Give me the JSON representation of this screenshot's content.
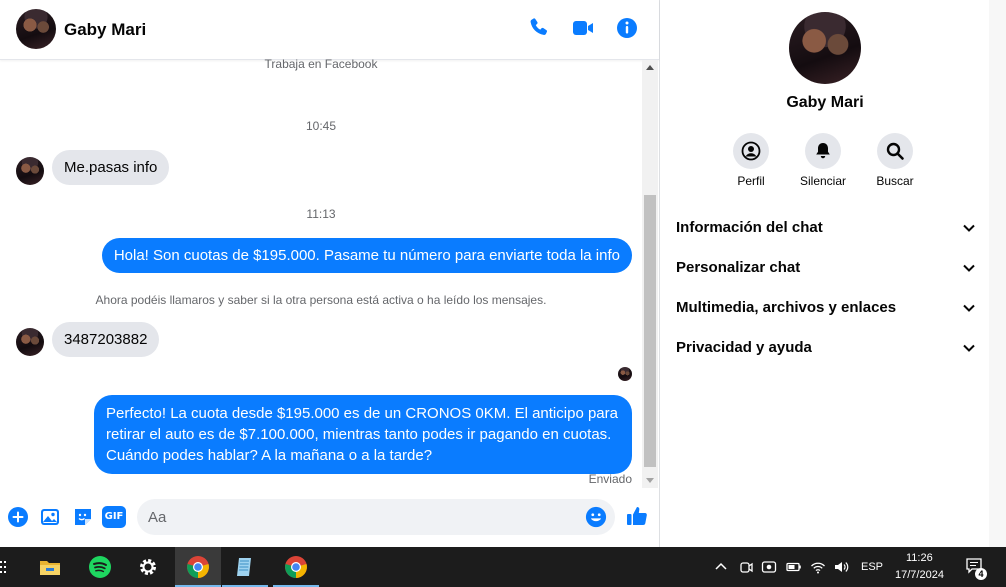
{
  "chat": {
    "contact_name": "Gaby Mari",
    "header_icons": [
      "phone-icon",
      "video-icon",
      "info-icon"
    ],
    "work_label": "Trabaja en Facebook",
    "messages": [
      {
        "kind": "time",
        "text": "10:45"
      },
      {
        "kind": "incoming",
        "text": "Me.pasas info"
      },
      {
        "kind": "time",
        "text": "11:13"
      },
      {
        "kind": "outgoing",
        "text": "Hola! Son cuotas de $195.000. Pasame tu número para enviarte toda la info"
      },
      {
        "kind": "system",
        "text": "Ahora podéis llamaros y saber si la otra persona está activa o ha leído los mensajes."
      },
      {
        "kind": "incoming",
        "text": "3487203882"
      },
      {
        "kind": "outgoing",
        "text": "Perfecto! La cuota desde $195.000 es de un CRONOS 0KM. El anticipo para retirar el auto es de $7.100.000, mientras tanto podes ir pagando en cuotas. Cuándo podes hablar? A la mañana o a la tarde?"
      }
    ],
    "status": "Enviado",
    "composer": {
      "placeholder": "Aa",
      "value": "",
      "icons": [
        "plus-icon",
        "image-icon",
        "sticker-icon",
        "gif-icon",
        "emoji-icon",
        "like-icon"
      ],
      "gif_label": "GIF"
    }
  },
  "panel": {
    "name": "Gaby Mari",
    "actions": [
      {
        "label": "Perfil",
        "icon": "profile-icon"
      },
      {
        "label": "Silenciar",
        "icon": "bell-icon"
      },
      {
        "label": "Buscar",
        "icon": "search-icon"
      }
    ],
    "sections": [
      "Información del chat",
      "Personalizar chat",
      "Multimedia, archivos y enlaces",
      "Privacidad y ayuda"
    ]
  },
  "taskbar": {
    "apps": [
      "file-explorer-icon",
      "spotify-icon",
      "settings-icon",
      "chrome-icon",
      "notepad-icon",
      "chrome-icon"
    ],
    "language": "ESP",
    "time": "11:26",
    "date": "17/7/2024",
    "notification_count": "4"
  },
  "colors": {
    "accent": "#0a7cff",
    "incoming_bubble": "#e4e6eb",
    "taskbar": "#1c1c1c"
  }
}
